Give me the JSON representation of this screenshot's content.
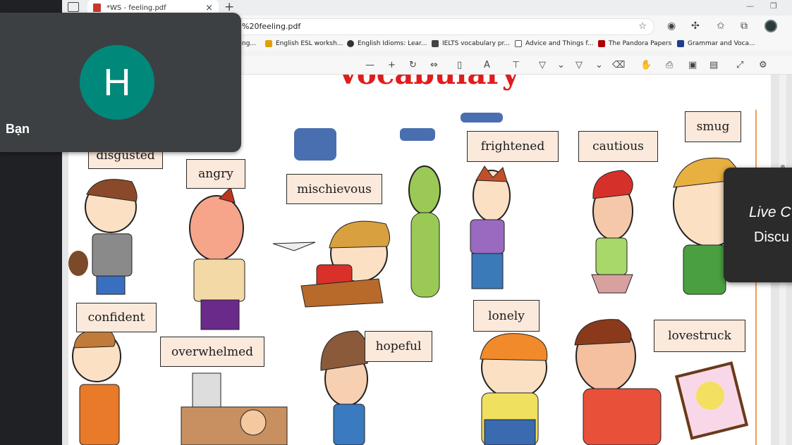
{
  "browser": {
    "tab_title": "*WS - feeling.pdf",
    "tab_close": "×",
    "new_tab": "+",
    "url": "%20feeling.pdf",
    "minimize": "—",
    "restore": "❐"
  },
  "bookmarks": [
    {
      "label": "ling...",
      "icon_color": "#ffffff"
    },
    {
      "label": "English ESL worksh...",
      "icon_color": "#e0a000"
    },
    {
      "label": "English Idioms: Lear...",
      "icon_color": "#333333"
    },
    {
      "label": "IELTS vocabulary pr...",
      "icon_color": "#444444"
    },
    {
      "label": "Advice and Things f...",
      "icon_color": "#ffffff"
    },
    {
      "label": "The Pandora Papers",
      "icon_color": "#b00000"
    },
    {
      "label": "Grammar and Voca...",
      "icon_color": "#1f3d8a"
    }
  ],
  "pdf": {
    "title": "Vocabulary",
    "words": {
      "disgusted": "disgusted",
      "angry": "angry",
      "mischievous": "mischievous",
      "frightened": "frightened",
      "cautious": "cautious",
      "smug": "smug",
      "confident": "confident",
      "overwhelmed": "overwhelmed",
      "hopeful": "hopeful",
      "lonely": "lonely",
      "lovestruck": "lovestruck"
    }
  },
  "call": {
    "avatar_letter": "H",
    "participant_name": "Bạn"
  },
  "live_card": {
    "title": "Live C",
    "subtitle": "Discu"
  },
  "colors": {
    "title_red": "#e11c1c",
    "word_box_fill": "#fbe9dc",
    "avatar_teal": "#00897b"
  }
}
